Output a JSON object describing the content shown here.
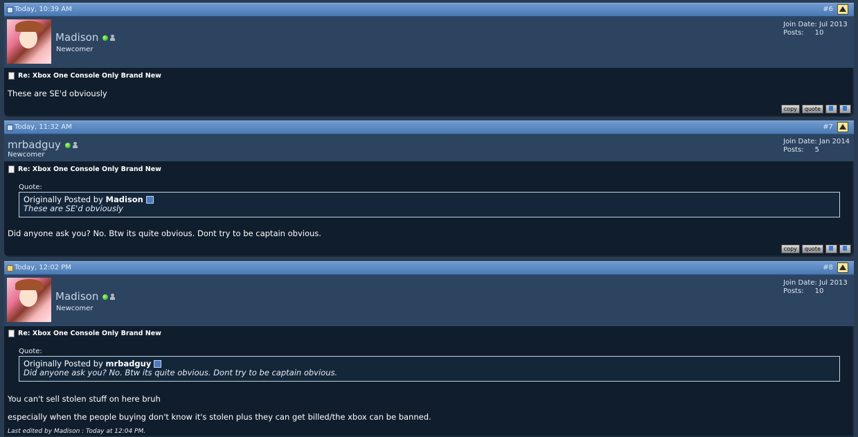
{
  "posts": [
    {
      "date": "Today, 10:39 AM",
      "number": "#6",
      "username": "Madison",
      "rank": "Newcomer",
      "join_date_label": "Join Date:",
      "join_date": "Jul 2013",
      "posts_label": "Posts:",
      "posts_count": "10",
      "title": "Re: Xbox One Console Only Brand New",
      "message": "These are SE'd obviously",
      "copy_label": "copy",
      "quote_label": "quote"
    },
    {
      "date": "Today, 11:32 AM",
      "number": "#7",
      "username": "mrbadguy",
      "rank": "Newcomer",
      "join_date_label": "Join Date:",
      "join_date": "Jan 2014",
      "posts_label": "Posts:",
      "posts_count": "5",
      "title": "Re: Xbox One Console Only Brand New",
      "quote_header": "Quote:",
      "quote_prefix": "Originally Posted by",
      "quote_author": "Madison",
      "quote_text": "These are SE'd obviously",
      "message": "Did anyone ask you? No. Btw its quite obvious. Dont try to be captain obvious.",
      "copy_label": "copy",
      "quote_label": "quote"
    },
    {
      "date": "Today, 12:02 PM",
      "number": "#8",
      "username": "Madison",
      "rank": "Newcomer",
      "join_date_label": "Join Date:",
      "join_date": "Jul 2013",
      "posts_label": "Posts:",
      "posts_count": "10",
      "title": "Re: Xbox One Console Only Brand New",
      "quote_header": "Quote:",
      "quote_prefix": "Originally Posted by",
      "quote_author": "mrbadguy",
      "quote_text": "Did anyone ask you? No. Btw its quite obvious. Dont try to be captain obvious.",
      "message_line1": "You can't sell stolen stuff on here bruh",
      "message_line2": "especially when the people buying don't know it's stolen plus they can get billed/the xbox can be banned.",
      "edited": "Last edited by Madison : Today at 12:04 PM."
    }
  ]
}
